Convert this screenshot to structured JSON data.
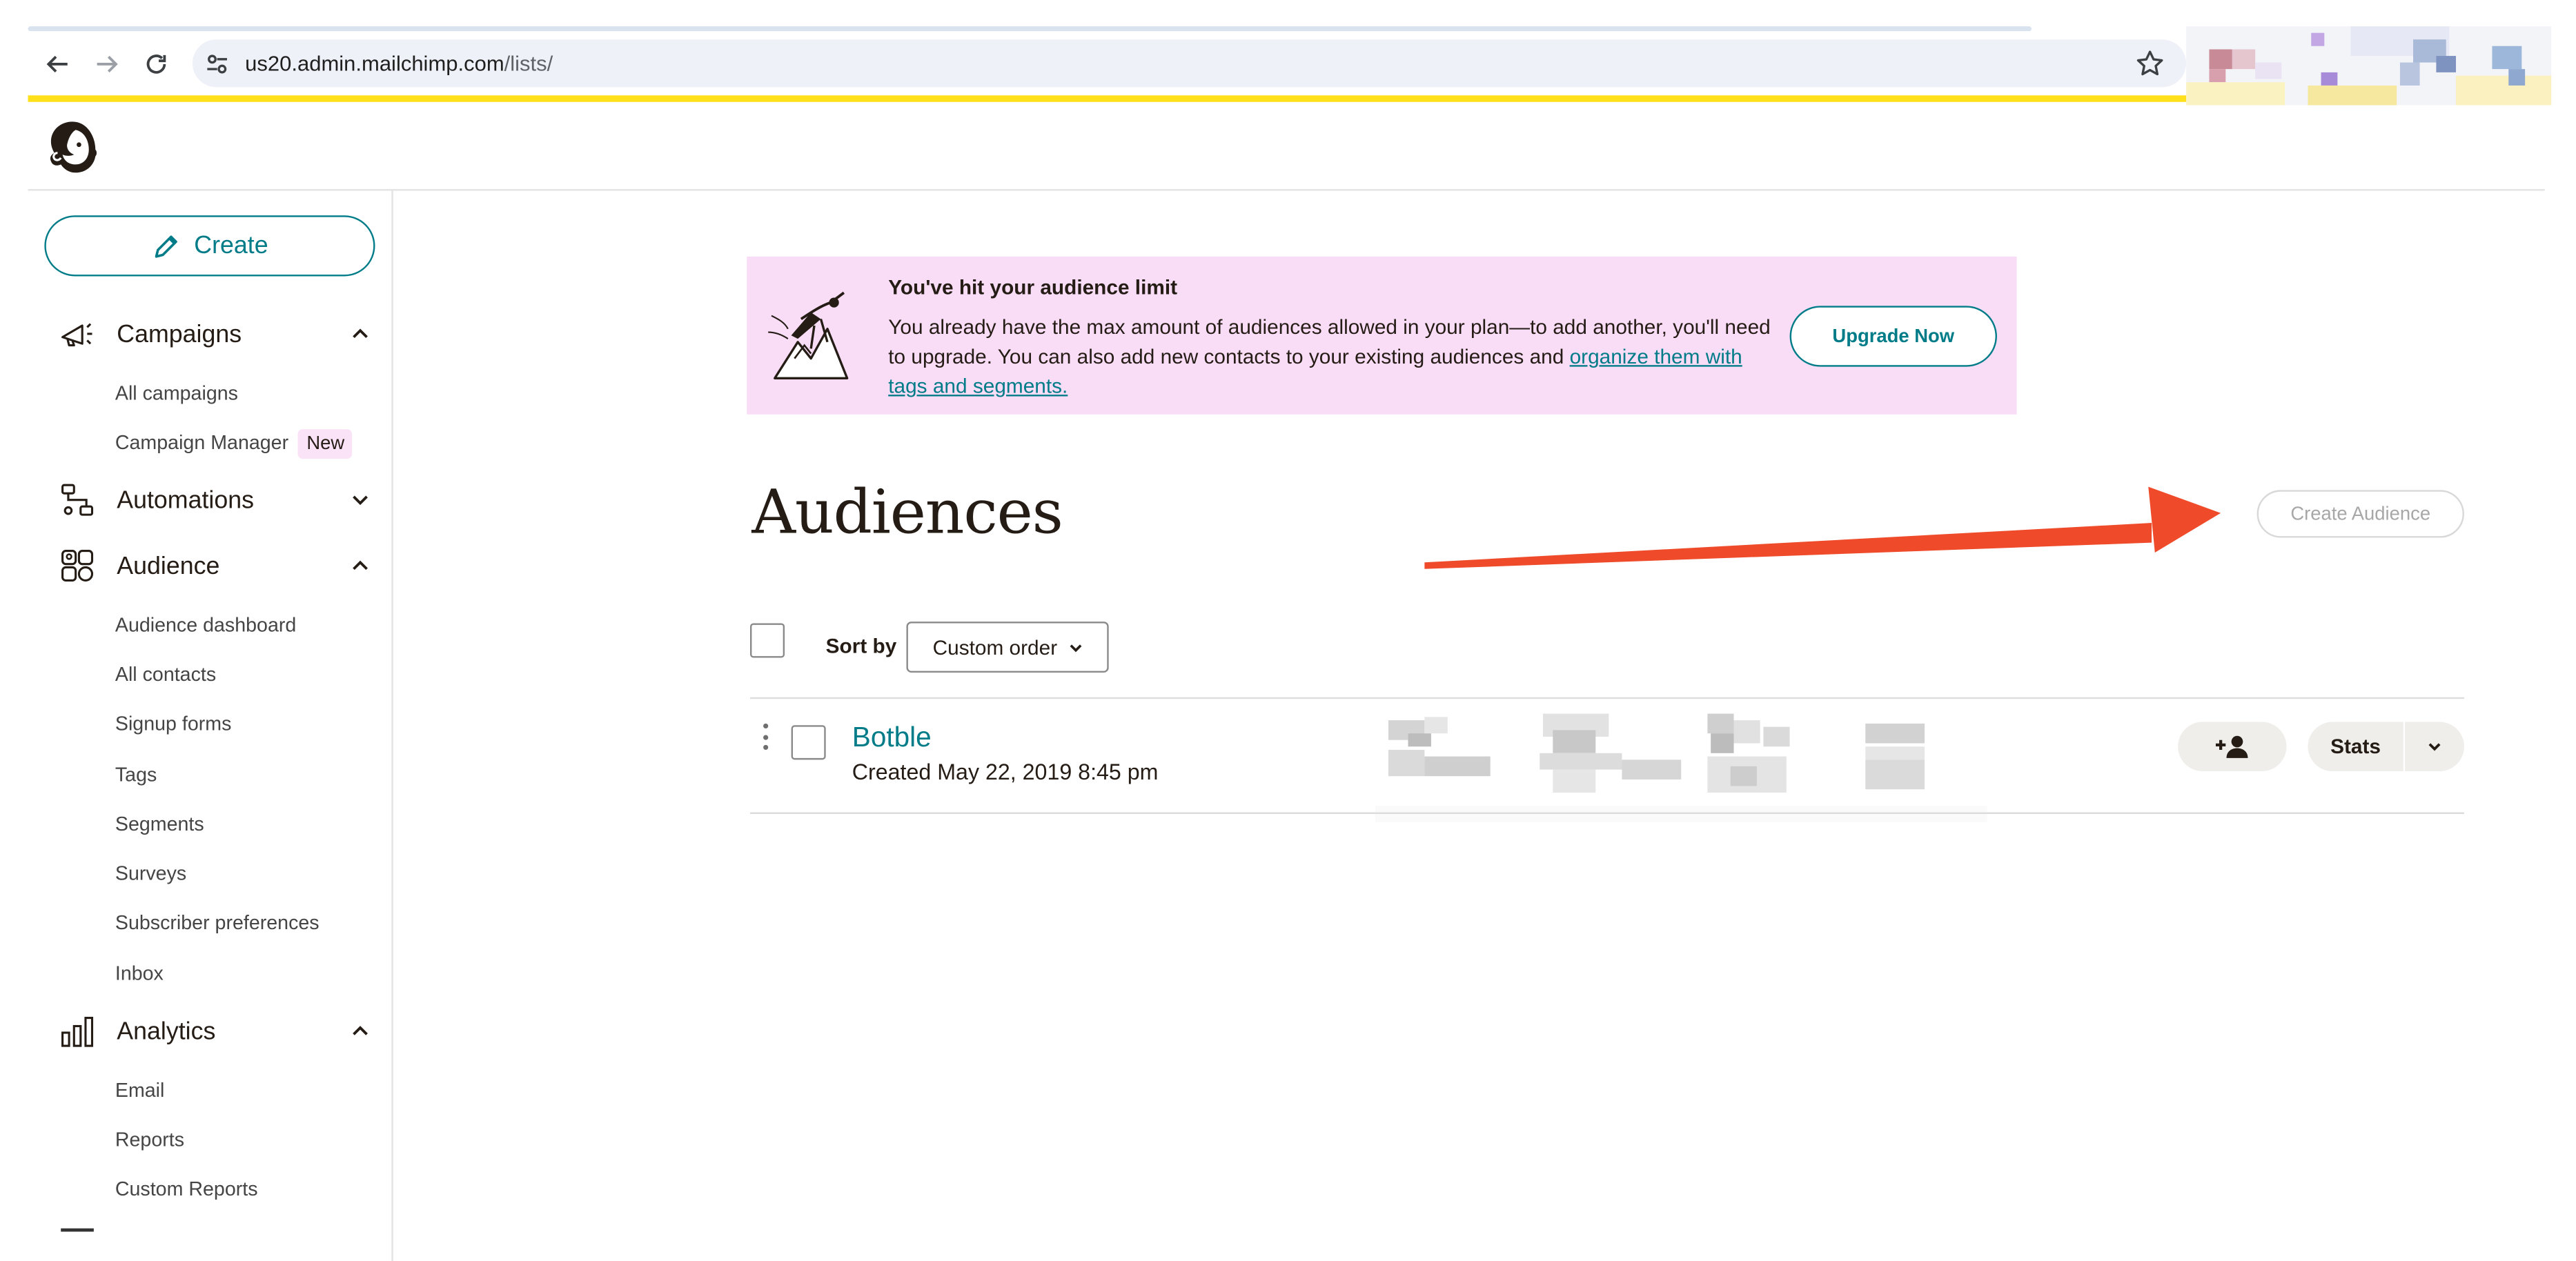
{
  "browser": {
    "url_host": "us20.admin.mailchimp.com",
    "url_path": "/lists/"
  },
  "sidebar": {
    "create_label": "Create",
    "sections": [
      {
        "label": "Campaigns",
        "icon": "megaphone-icon",
        "expanded": true,
        "items": [
          {
            "label": "All campaigns"
          },
          {
            "label": "Campaign Manager",
            "badge": "New"
          }
        ]
      },
      {
        "label": "Automations",
        "icon": "automations-icon",
        "expanded": false,
        "items": []
      },
      {
        "label": "Audience",
        "icon": "audience-icon",
        "expanded": true,
        "items": [
          {
            "label": "Audience dashboard"
          },
          {
            "label": "All contacts"
          },
          {
            "label": "Signup forms"
          },
          {
            "label": "Tags"
          },
          {
            "label": "Segments"
          },
          {
            "label": "Surveys"
          },
          {
            "label": "Subscriber preferences"
          },
          {
            "label": "Inbox"
          }
        ]
      },
      {
        "label": "Analytics",
        "icon": "bar-chart-icon",
        "expanded": true,
        "items": [
          {
            "label": "Email"
          },
          {
            "label": "Reports"
          },
          {
            "label": "Custom Reports"
          }
        ]
      }
    ]
  },
  "banner": {
    "title": "You've hit your audience limit",
    "body_prefix": "You already have the max amount of audiences allowed in your plan—to add another, you'll need to upgrade. You can also add new contacts to your existing audiences and ",
    "body_link": "organize them with tags and segments.",
    "upgrade_label": "Upgrade Now"
  },
  "main": {
    "title": "Audiences",
    "create_audience_label": "Create Audience",
    "sort_label": "Sort by",
    "sort_value": "Custom order",
    "lists": [
      {
        "name": "Botble",
        "created": "Created May 22, 2019 8:45 pm",
        "stats_label": "Stats"
      }
    ]
  },
  "colors": {
    "accent": "#007c89",
    "brand_yellow": "#ffe01b",
    "banner_bg": "#f9ddf6",
    "annotation_arrow": "#ef4b2a"
  }
}
